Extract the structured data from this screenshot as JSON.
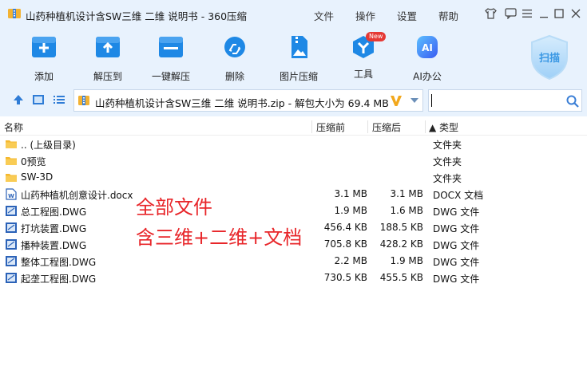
{
  "window": {
    "title": "山药种植机设计含SW三维 二维 说明书 - 360压缩",
    "menu": [
      "文件",
      "操作",
      "设置",
      "帮助"
    ]
  },
  "toolbar": {
    "tools": [
      {
        "label": "添加",
        "icon": "add-icon"
      },
      {
        "label": "解压到",
        "icon": "extract-to-icon"
      },
      {
        "label": "一键解压",
        "icon": "one-click-extract-icon"
      },
      {
        "label": "删除",
        "icon": "recycle-delete-icon"
      },
      {
        "label": "图片压缩",
        "icon": "image-compress-icon"
      },
      {
        "label": "工具",
        "icon": "tools-icon",
        "badge": "New"
      },
      {
        "label": "AI办公",
        "icon": "ai-office-icon"
      }
    ],
    "scan_label": "扫描"
  },
  "address": {
    "path": "山药种植机设计含SW三维 二维 说明书.zip - 解包大小为 69.4 MB",
    "search_value": ""
  },
  "columns": {
    "name": "名称",
    "compressed": "压缩前",
    "original": "压缩后",
    "type": "▲ 类型"
  },
  "rows": [
    {
      "name": ".. (上级目录)",
      "compressed": "",
      "original": "",
      "type": "文件夹",
      "icon": "folder-icon"
    },
    {
      "name": "0预览",
      "compressed": "",
      "original": "",
      "type": "文件夹",
      "icon": "folder-icon"
    },
    {
      "name": "SW-3D",
      "compressed": "",
      "original": "",
      "type": "文件夹",
      "icon": "folder-icon"
    },
    {
      "name": "山药种植机创意设计.docx",
      "compressed": "3.1 MB",
      "original": "3.1 MB",
      "type": "DOCX 文档",
      "icon": "docx-icon"
    },
    {
      "name": "总工程图.DWG",
      "compressed": "1.9 MB",
      "original": "1.6 MB",
      "type": "DWG 文件",
      "icon": "dwg-icon"
    },
    {
      "name": "打坑装置.DWG",
      "compressed": "456.4 KB",
      "original": "188.5 KB",
      "type": "DWG 文件",
      "icon": "dwg-icon"
    },
    {
      "name": "播种装置.DWG",
      "compressed": "705.8 KB",
      "original": "428.2 KB",
      "type": "DWG 文件",
      "icon": "dwg-icon"
    },
    {
      "name": "整体工程图.DWG",
      "compressed": "2.2 MB",
      "original": "1.9 MB",
      "type": "DWG 文件",
      "icon": "dwg-icon"
    },
    {
      "name": "起垄工程图.DWG",
      "compressed": "730.5 KB",
      "original": "455.5 KB",
      "type": "DWG 文件",
      "icon": "dwg-icon"
    }
  ],
  "overlay": {
    "line1": "全部文件",
    "line2": "含三维+二维+文档"
  },
  "colors": {
    "accent": "#1e88e5",
    "toolbar_bg": "#e8f2fd",
    "overlay_red": "#e8262a",
    "folder": "#f5b82e"
  }
}
